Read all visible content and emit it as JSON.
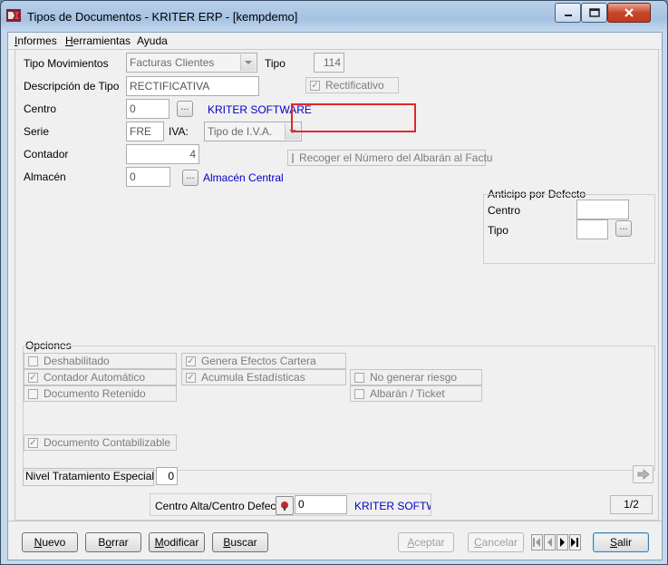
{
  "window": {
    "title": "Tipos de Documentos - KRITER ERP - [kempdemo]"
  },
  "menu": {
    "items": [
      {
        "u": "I",
        "rest": "nformes"
      },
      {
        "u": "H",
        "rest": "erramientas"
      },
      {
        "u": "",
        "rest": "Ayuda"
      }
    ]
  },
  "form": {
    "tipo_movimientos": {
      "label": "Tipo Movimientos",
      "value": "Facturas Clientes"
    },
    "tipo": {
      "label": "Tipo",
      "value": "114"
    },
    "descripcion": {
      "label": "Descripción de Tipo",
      "value": "RECTIFICATIVA"
    },
    "rectificativo": {
      "label": "Rectificativo",
      "checked": true
    },
    "centro": {
      "label": "Centro",
      "value": "0",
      "link": "KRITER SOFTWARE"
    },
    "serie": {
      "label": "Serie",
      "value": "FRE"
    },
    "iva": {
      "label": "IVA:",
      "value": "Tipo de I.V.A."
    },
    "contador": {
      "label": "Contador",
      "value": "4"
    },
    "recoger": {
      "label": "Recoger el Número del Albarán al Factu",
      "checked": false
    },
    "almacen": {
      "label": "Almacén",
      "value": "0",
      "link": "Almacén Central"
    },
    "anticipo": {
      "title": "Anticipo por Defecto",
      "centro_label": "Centro",
      "tipo_label": "Tipo",
      "centro_value": "",
      "tipo_value": ""
    },
    "opciones": {
      "title": "Opciones",
      "deshabilitado": {
        "label": "Deshabilitado",
        "checked": false
      },
      "contador_automatico": {
        "label": "Contador Automático",
        "checked": true
      },
      "documento_retenido": {
        "label": "Documento Retenido",
        "checked": false
      },
      "genera_efectos": {
        "label": "Genera Efectos Cartera",
        "checked": true
      },
      "acumula_estadisticas": {
        "label": "Acumula Estadísticas",
        "checked": true
      },
      "no_generar_riesgo": {
        "label": "No generar riesgo",
        "checked": false
      },
      "albaran_ticket": {
        "label": "Albarán / Ticket",
        "checked": false
      },
      "documento_contabilizable": {
        "label": "Documento Contabilizable",
        "checked": true
      }
    },
    "nivel_tratamiento": {
      "label": "Nivel Tratamiento Especial",
      "value": "0"
    }
  },
  "footer": {
    "centro_alta": {
      "label": "Centro Alta/Centro Defecto",
      "value": "0",
      "link": "KRITER SOFTWA"
    },
    "page": "1/2"
  },
  "buttons": {
    "nuevo": {
      "u": "N",
      "rest": "uevo"
    },
    "borrar": {
      "pre": "B",
      "u": "o",
      "rest": "rrar"
    },
    "modificar": {
      "u": "M",
      "rest": "odificar"
    },
    "buscar": {
      "u": "B",
      "rest": "uscar"
    },
    "aceptar": {
      "u": "A",
      "rest": "ceptar"
    },
    "cancelar": {
      "u": "C",
      "rest": "ancelar"
    },
    "salir": {
      "u": "S",
      "rest": "alir"
    }
  },
  "colors": {
    "highlight": "#e2262f",
    "link": "#0000c8"
  }
}
